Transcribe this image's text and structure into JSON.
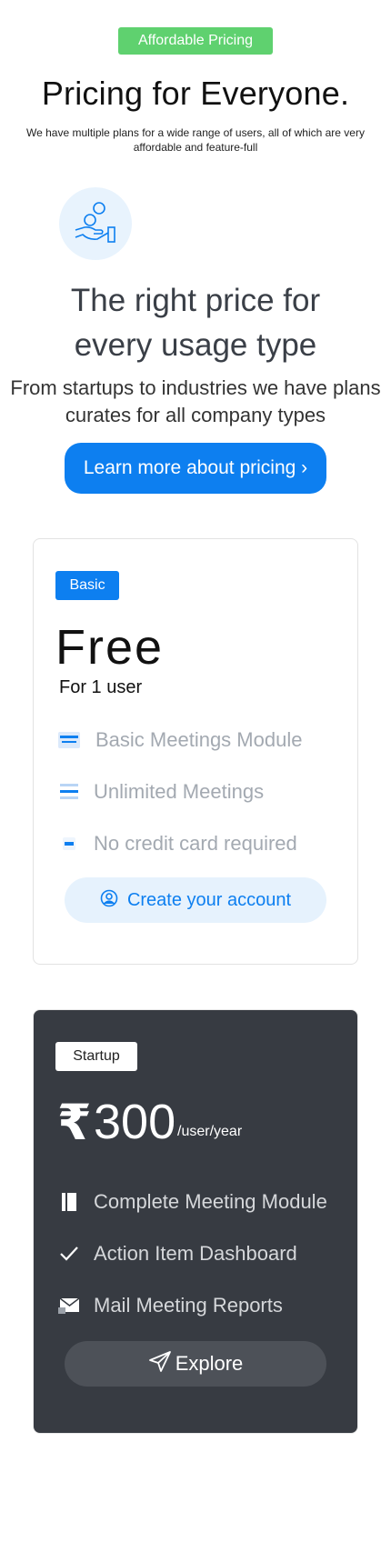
{
  "hero": {
    "badge": "Affordable Pricing",
    "title": "Pricing for Everyone.",
    "subtitle": "We have multiple plans for a wide range of users, all of which are very affordable and feature-full"
  },
  "usage": {
    "icon": "hand-coins-icon",
    "title_line1": "The right price for",
    "title_line2": "every usage type",
    "description": "From startups to industries we have plans curates for all company types",
    "cta_label": "Learn more about pricing ›"
  },
  "plans": [
    {
      "tier": "Basic",
      "price": "Free",
      "price_note": "For 1 user",
      "features": [
        {
          "icon": "card-icon",
          "label": "Basic Meetings Module"
        },
        {
          "icon": "list-icon",
          "label": "Unlimited Meetings"
        },
        {
          "icon": "dash-icon",
          "label": "No credit card required"
        }
      ],
      "cta_label": "Create your account",
      "cta_icon": "user-circle-icon"
    },
    {
      "tier": "Startup",
      "currency": "₹",
      "price": "300",
      "price_unit": "/user/year",
      "features": [
        {
          "icon": "document-icon",
          "label": "Complete Meeting Module"
        },
        {
          "icon": "check-icon",
          "label": "Action Item Dashboard"
        },
        {
          "icon": "mail-icon",
          "label": "Mail Meeting Reports"
        }
      ],
      "cta_label": "Explore",
      "cta_icon": "paper-plane-icon"
    }
  ],
  "colors": {
    "accent": "#0d7ff0",
    "badge_green": "#5fd16f",
    "dark_card": "#373b42"
  }
}
